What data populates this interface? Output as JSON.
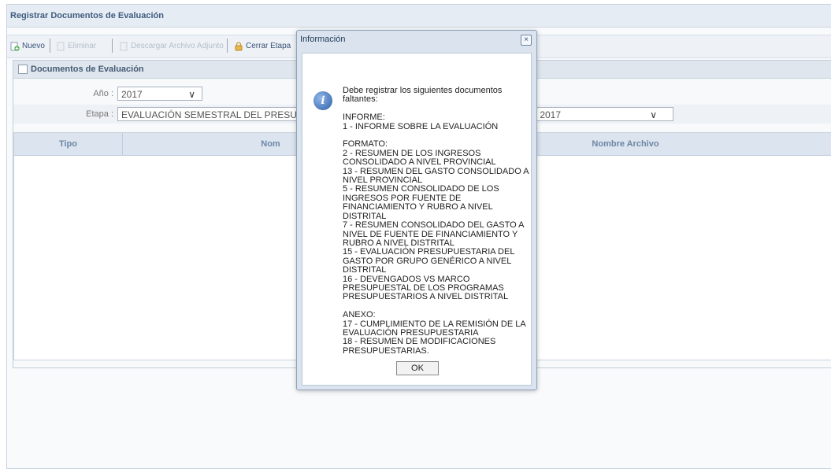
{
  "panel": {
    "title": "Registrar Documentos de Evaluación"
  },
  "toolbar": {
    "nuevo": "Nuevo",
    "eliminar": "Eliminar",
    "descargar": "Descargar Archivo Adjunto",
    "cerrar_etapa": "Cerrar Etapa"
  },
  "section": {
    "title": "Documentos de Evaluación"
  },
  "form": {
    "anio_label": "Año :",
    "anio_value": "2017",
    "etapa_label": "Etapa :",
    "etapa_value_left": "EVALUACIÓN SEMESTRAL DEL PRESUP",
    "etapa_value_right": "S 2017"
  },
  "grid": {
    "columns": [
      "Tipo",
      "Nom",
      "Nombre Archivo"
    ]
  },
  "dialog": {
    "title": "Información",
    "close": "×",
    "message": "Debe registrar los siguientes documentos\nfaltantes:\n\nINFORME:\n1 - INFORME SOBRE LA EVALUACIÓN\n\nFORMATO:\n2 - RESUMEN DE LOS INGRESOS\nCONSOLIDADO A NIVEL PROVINCIAL\n13 - RESUMEN DEL GASTO CONSOLIDADO A\nNIVEL PROVINCIAL\n5 - RESUMEN CONSOLIDADO DE LOS\nINGRESOS POR FUENTE DE\nFINANCIAMIENTO Y RUBRO A NIVEL\nDISTRITAL\n7 - RESUMEN CONSOLIDADO DEL GASTO A\nNIVEL DE FUENTE DE FINANCIAMIENTO Y\nRUBRO A NIVEL DISTRITAL\n15 - EVALUACIÓN PRESUPUESTARIA DEL\nGASTO POR GRUPO GENÉRICO A NIVEL\nDISTRITAL\n16 - DEVENGADOS VS MARCO\nPRESUPUESTAL DE LOS PROGRAMAS\nPRESUPUESTARIOS A NIVEL DISTRITAL\n\nANEXO:\n17 - CUMPLIMIENTO DE LA REMISIÓN DE LA\nEVALUACIÓN PRESUPUESTARIA\n18 - RESUMEN DE MODIFICACIONES\nPRESUPUESTARIAS.",
    "ok": "OK"
  }
}
